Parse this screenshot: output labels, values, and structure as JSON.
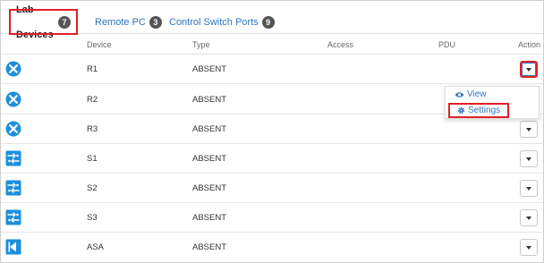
{
  "tabs": [
    {
      "label": "Lab Devices",
      "count": "7",
      "active": true
    },
    {
      "label": "Remote PC",
      "count": "3",
      "active": false
    },
    {
      "label": "Control Switch Ports",
      "count": "9",
      "active": false
    }
  ],
  "table": {
    "headers": {
      "device": "Device",
      "type": "Type",
      "access": "Access",
      "pdu": "PDU",
      "action": "Action"
    },
    "rows": [
      {
        "device": "R1",
        "type": "ABSENT",
        "icon": "router-icon"
      },
      {
        "device": "R2",
        "type": "ABSENT",
        "icon": "router-icon"
      },
      {
        "device": "R3",
        "type": "ABSENT",
        "icon": "router-icon"
      },
      {
        "device": "S1",
        "type": "ABSENT",
        "icon": "switch-icon"
      },
      {
        "device": "S2",
        "type": "ABSENT",
        "icon": "switch-icon"
      },
      {
        "device": "S3",
        "type": "ABSENT",
        "icon": "switch-icon"
      },
      {
        "device": "ASA",
        "type": "ABSENT",
        "icon": "firewall-icon"
      }
    ]
  },
  "action_menu": {
    "view_label": "View",
    "settings_label": "Settings"
  },
  "colors": {
    "accent": "#2f74c0",
    "icon_blue": "#1e8fdc",
    "highlight": "#e01f26"
  }
}
